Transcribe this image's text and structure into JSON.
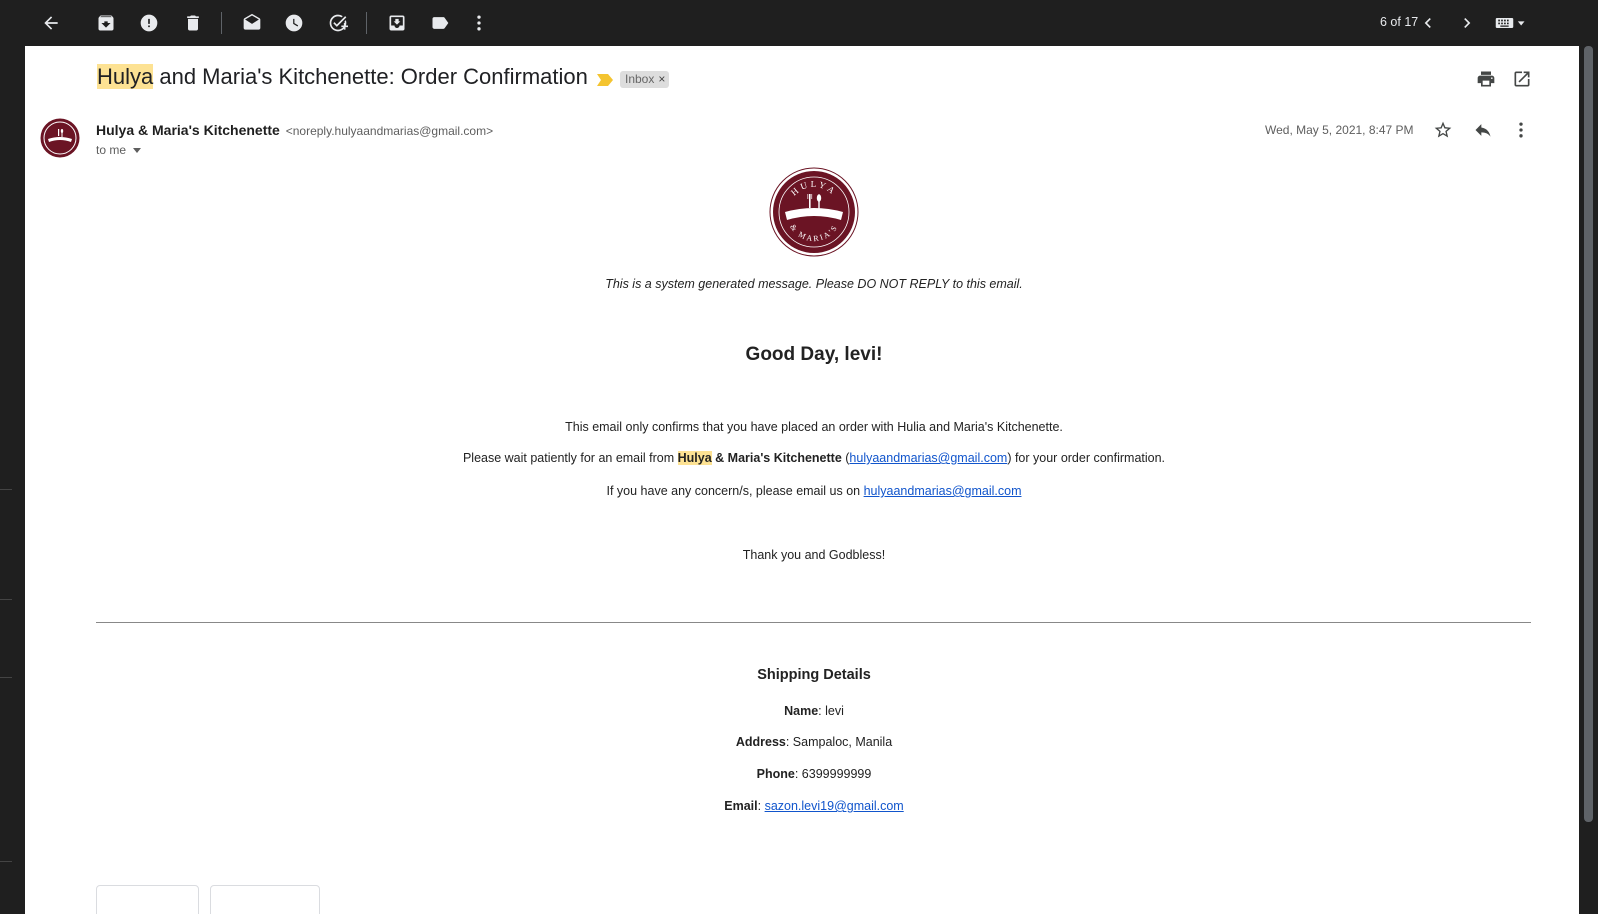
{
  "toolbar": {
    "counter": "6 of 17",
    "icons": [
      "back-arrow-icon",
      "archive-icon",
      "report-spam-icon",
      "delete-icon",
      "mark-unread-icon",
      "snooze-icon",
      "add-task-icon",
      "move-to-icon",
      "label-icon",
      "more-vert-icon",
      "older-icon",
      "newer-icon",
      "keyboard-icon"
    ]
  },
  "email": {
    "subject_highlight": "Hulya",
    "subject_rest": " and Maria's Kitchenette: Order Confirmation",
    "label_chip": "Inbox",
    "label_chip_close": "×",
    "sender_name": "Hulya & Maria's Kitchenette",
    "sender_email": "<noreply.hulyaandmarias@gmail.com>",
    "to_line": "to me",
    "date": "Wed, May 5, 2021, 8:47 PM"
  },
  "body": {
    "logo_text_top": "HULYA",
    "logo_text_bottom": "& MARIA'S",
    "system_message": "This is a system generated message. Please DO NOT REPLY to this email.",
    "greeting": "Good Day, levi!",
    "line1": "This email only confirms that you have placed an order with Hulia and Maria's Kitchenette.",
    "line2_pre": "Please wait patiently for an email from ",
    "line2_highlight": "Hulya",
    "line2_bold_rest": " & Maria's Kitchenette",
    "line2_mid": " (",
    "line2_link": "hulyaandmarias@gmail.com",
    "line2_post": ") for your order confirmation.",
    "line3_pre": "If you have any concern/s, please email us on ",
    "line3_link": "hulyaandmarias@gmail.com",
    "thanks": "Thank you and Godbless!"
  },
  "shipping": {
    "title": "Shipping Details",
    "name_label": "Name",
    "name_value": ": levi",
    "address_label": "Address",
    "address_value": ": Sampaloc, Manila",
    "phone_label": "Phone",
    "phone_value": ": 6399999999",
    "email_label": "Email",
    "email_sep": ": ",
    "email_value": "sazon.levi19@gmail.com"
  },
  "colors": {
    "highlight": "#fde293",
    "brand_maroon": "#6b1424",
    "link": "#1155cc",
    "importance_marker": "#f4c430"
  }
}
